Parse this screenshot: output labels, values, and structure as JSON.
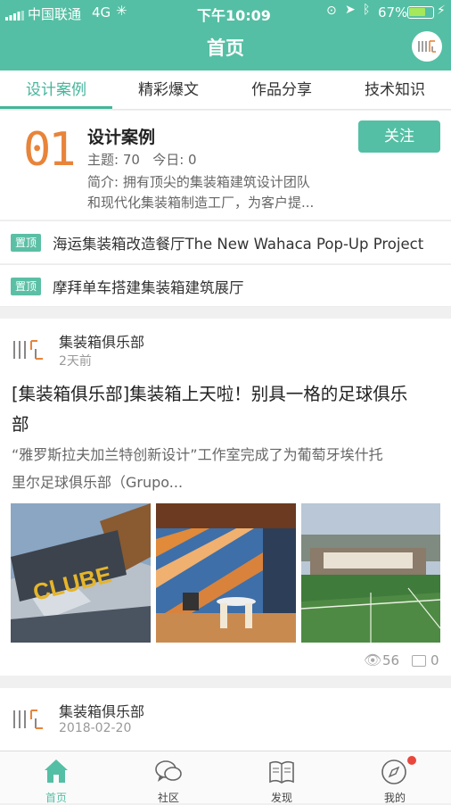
{
  "status_bar": {
    "carrier": "中国联通",
    "network": "4G",
    "time": "下午10:09",
    "battery": "67%"
  },
  "nav": {
    "title": "首页"
  },
  "tabs": [
    {
      "label": "设计案例",
      "active": true
    },
    {
      "label": "精彩爆文",
      "active": false
    },
    {
      "label": "作品分享",
      "active": false
    },
    {
      "label": "技术知识",
      "active": false
    }
  ],
  "topic": {
    "badge": "01",
    "title": "设计案例",
    "stats": "主题: 70   今日: 0",
    "desc_line1": "简介: 拥有顶尖的集装箱建筑设计团队",
    "desc_line2": "和现代化集装箱制造工厂，为客户提...",
    "follow_label": "关注"
  },
  "pinned": [
    {
      "badge": "置顶",
      "title": "海运集装箱改造餐厅The New Wahaca Pop-Up Project"
    },
    {
      "badge": "置顶",
      "title": "摩拜单车搭建集装箱建筑展厅"
    }
  ],
  "posts": [
    {
      "author": "集装箱俱乐部",
      "time": "2天前",
      "title_line1": "[集装箱俱乐部]集装箱上天啦！别具一格的足球俱乐",
      "title_line2": "部",
      "excerpt_line1": "“雅罗斯拉夫加兰特创新设计”工作室完成了为葡萄牙埃什托",
      "excerpt_line2": "里尔足球俱乐部（Grupo...",
      "image_sign_text": "CLUBE",
      "views": "56",
      "comments": "0"
    },
    {
      "author": "集装箱俱乐部",
      "time": "2018-02-20"
    }
  ],
  "tabbar": [
    {
      "label": "首页",
      "icon": "home-icon",
      "active": true
    },
    {
      "label": "社区",
      "icon": "chat-bubbles-icon",
      "active": false
    },
    {
      "label": "发现",
      "icon": "book-icon",
      "active": false
    },
    {
      "label": "我的",
      "icon": "compass-icon",
      "active": false,
      "badge_dot": true
    }
  ],
  "colors": {
    "brand": "#54bfa4",
    "accent_text": "#45b59b",
    "badge_orange": "#e8843a",
    "notify_red": "#e8473c"
  }
}
